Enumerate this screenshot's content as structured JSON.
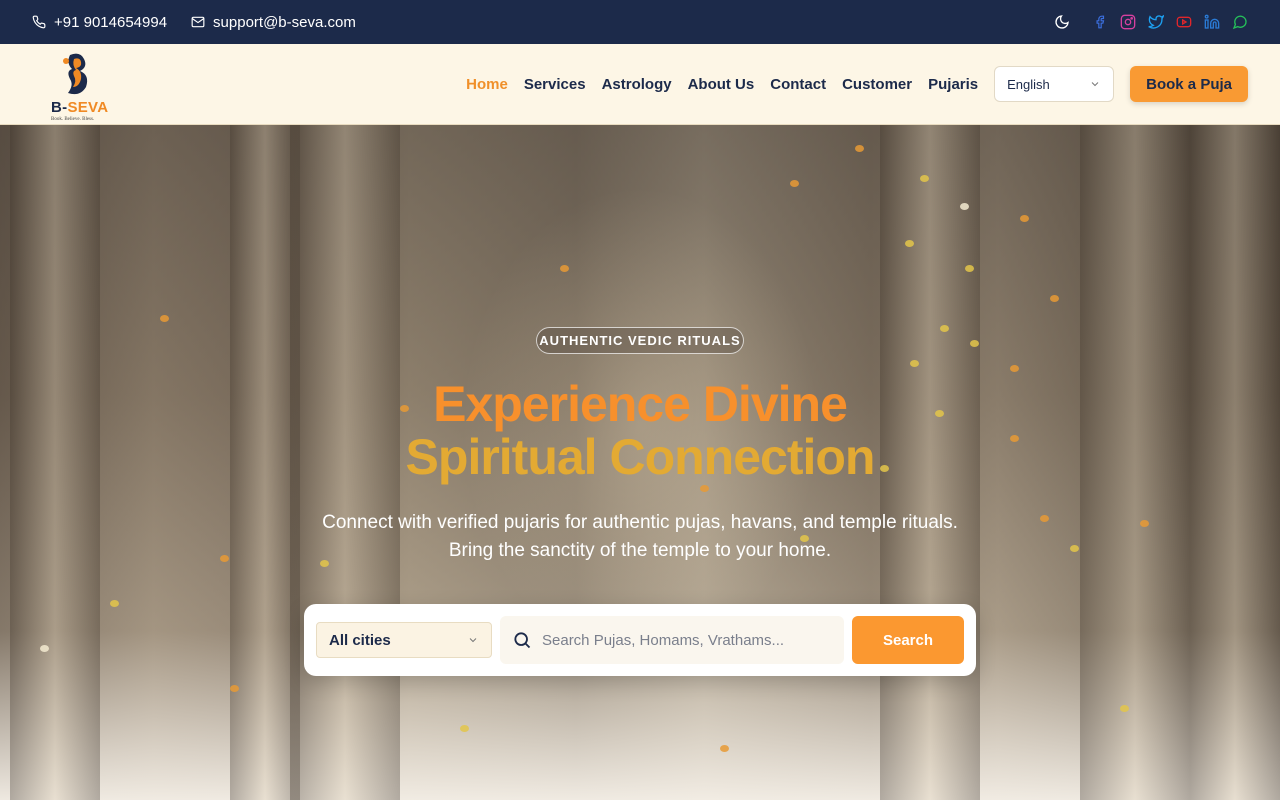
{
  "topbar": {
    "phone": "+91 9014654994",
    "email": "support@b-seva.com",
    "social_icons": [
      "facebook-icon",
      "instagram-icon",
      "twitter-icon",
      "youtube-icon",
      "linkedin-icon",
      "whatsapp-icon"
    ]
  },
  "header": {
    "brand_prefix": "B-",
    "brand_accent": "SEVA",
    "tagline": "Book. Believe. Bless.",
    "nav": [
      {
        "label": "Home",
        "active": true
      },
      {
        "label": "Services"
      },
      {
        "label": "Astrology"
      },
      {
        "label": "About Us"
      },
      {
        "label": "Contact"
      },
      {
        "label": "Customer"
      },
      {
        "label": "Pujaris"
      }
    ],
    "language": "English",
    "cta": "Book a Puja"
  },
  "hero": {
    "badge": "AUTHENTIC VEDIC RITUALS",
    "title_line1": "Experience Divine",
    "title_line2": "Spiritual Connection",
    "subtitle": "Connect with verified pujaris for authentic pujas, havans, and temple rituals. Bring the sanctity of the temple to your home.",
    "search": {
      "city": "All cities",
      "placeholder": "Search Pujas, Homams, Vrathams...",
      "button": "Search"
    }
  },
  "colors": {
    "topbar_bg": "#1c2a4a",
    "header_bg": "#fdf6e6",
    "accent": "#f7902c",
    "accent_gold": "#e3aa33",
    "navy": "#1c2a4a"
  }
}
